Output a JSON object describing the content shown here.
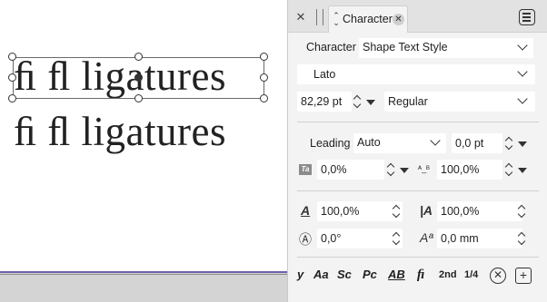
{
  "canvas": {
    "line1": "ﬁ ﬂ ligatures",
    "line2": "ﬁ ﬂ ligatures"
  },
  "panel": {
    "tab_label": "Character",
    "character_label": "Character",
    "character_style": "Shape Text Style",
    "font_family": "Lato",
    "font_size": "82,29 pt",
    "font_style": "Regular",
    "leading_label": "Leading",
    "leading_mode": "Auto",
    "leading_value": "0,0 pt",
    "tracking_value": "0,0%",
    "tracking_icon_text": "Ta",
    "kerning_value": "100,0%",
    "horizontal_scale": "100,0%",
    "vertical_scale": "100,0%",
    "rotation": "0,0°",
    "baseline_shift": "0,0 mm",
    "bottom_bar": {
      "y": "y",
      "aa": "Aa",
      "sc": "Sc",
      "pc": "Pc",
      "ab": "AB",
      "fi": "ﬁ",
      "second": "2nd",
      "fraction": "1/4"
    }
  },
  "colors": {
    "page_edge": "#6d62a8",
    "panel_bg": "#f3f3f3",
    "tab_bar_bg": "#e2e2e2"
  }
}
